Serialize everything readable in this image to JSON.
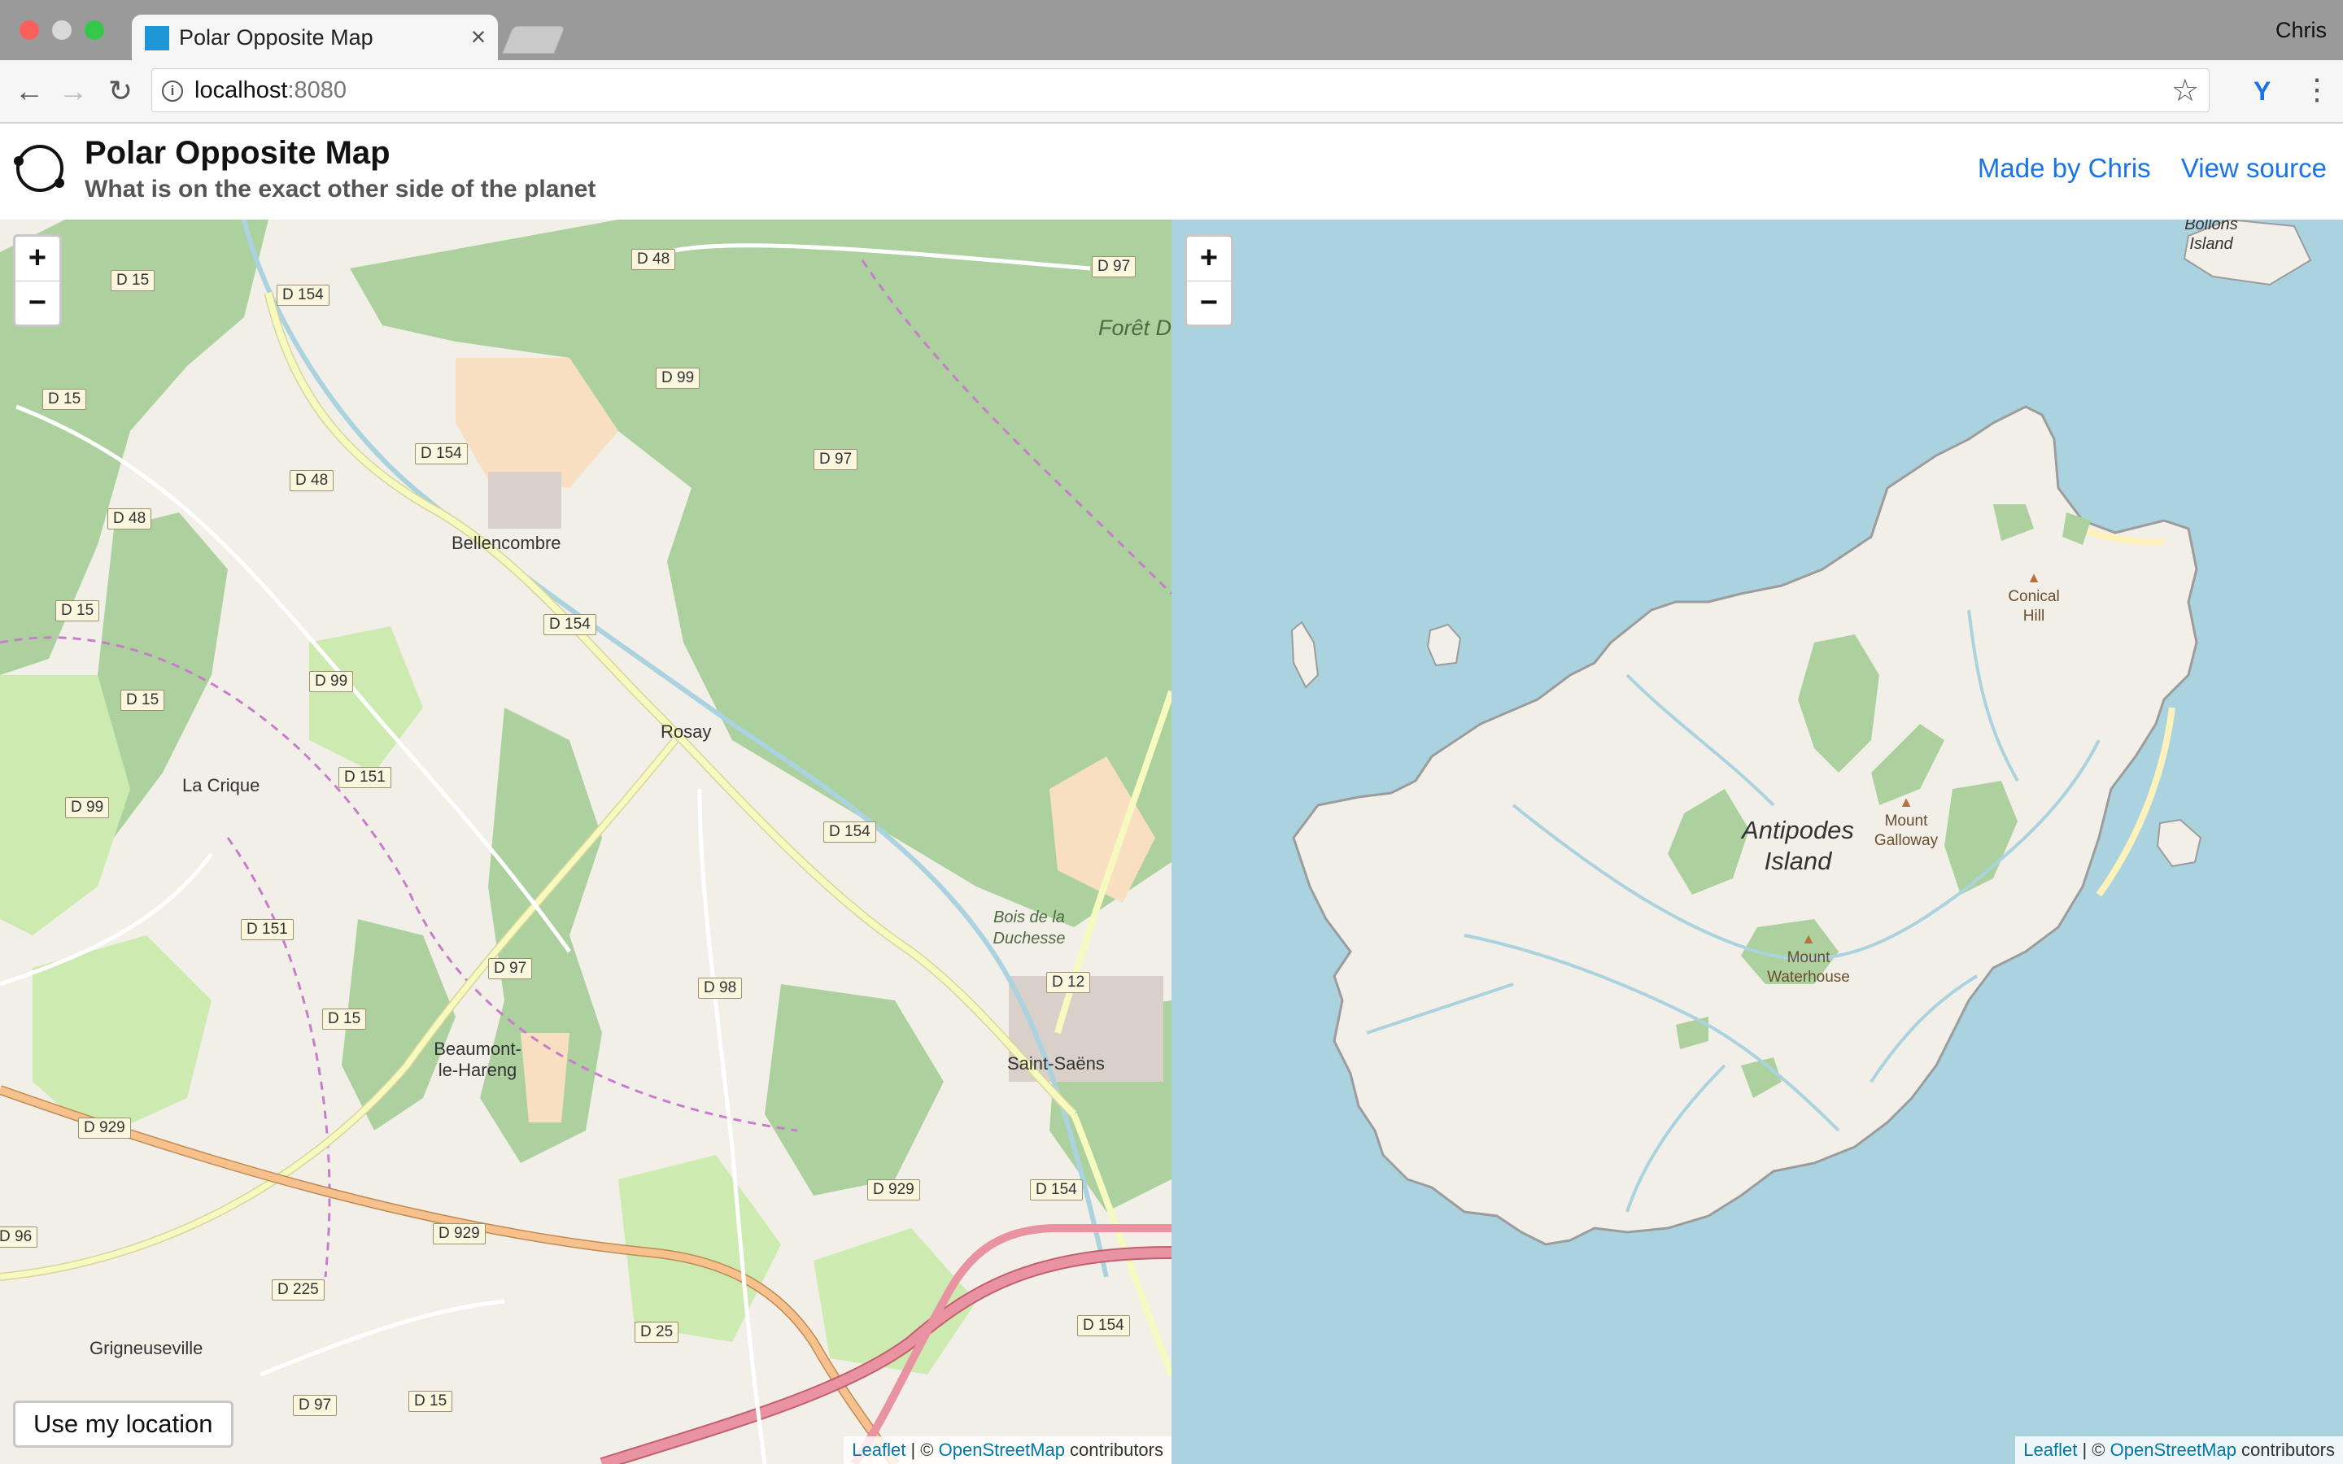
{
  "browser": {
    "tab_title": "Polar Opposite Map",
    "tab_close": "×",
    "profile_name": "Chris",
    "url_host": "localhost",
    "url_port": ":8080"
  },
  "header": {
    "title": "Polar Opposite Map",
    "subtitle": "What is on the exact other side of the planet",
    "links": [
      "Made by Chris",
      "View source"
    ]
  },
  "map_left": {
    "zoom_in": "+",
    "zoom_out": "−",
    "locate_button": "Use my location",
    "places": [
      "Bellencombre",
      "Rosay",
      "La Crique",
      "Beaumont-le-Hareng",
      "Saint-Saëns",
      "Grigneuseville",
      "Bois de la Duchesse",
      "Forêt D"
    ],
    "road_labels": [
      "D 15",
      "D 154",
      "D 48",
      "D 99",
      "D 97",
      "D 151",
      "D 98",
      "D 12",
      "D 929",
      "D 225",
      "D 25",
      "D 96"
    ],
    "attribution": {
      "leaflet": "Leaflet",
      "sep": " | © ",
      "osm": "OpenStreetMap",
      "suffix": " contributors"
    }
  },
  "map_right": {
    "zoom_in": "+",
    "zoom_out": "−",
    "island_label": "Antipodes Island",
    "bollons_label": "Bollons Island",
    "peaks": [
      "Conical Hill",
      "Mount Galloway",
      "Mount Waterhouse"
    ],
    "attribution": {
      "leaflet": "Leaflet",
      "sep": " | © ",
      "osm": "OpenStreetMap",
      "suffix": " contributors"
    }
  },
  "colors": {
    "forest": "#add19e",
    "meadow": "#cdebb0",
    "farmland": "#f2efe9",
    "water": "#aad3df",
    "motorway": "#e892a2",
    "trunk": "#f6c18c",
    "secondary": "#f7fabf",
    "link": "#1a73e8"
  }
}
